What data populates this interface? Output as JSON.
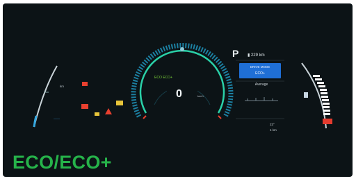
{
  "caption": "ECO/ECO+",
  "cluster": {
    "gear": "P",
    "range": "▮ 229 km",
    "drive_mode_title": "DRIVE MODE",
    "drive_mode": "ECO+",
    "average_label": "Average",
    "speed": "0",
    "speed_unit": "km/h",
    "eco_readout": "ECO   ECO+",
    "odometer": "23°",
    "trip": "1 km",
    "left_label": "km",
    "left_bottom": "——"
  },
  "colors": {
    "caption": "#26b34a",
    "panel": "#0c1316",
    "gauge_outer": "#1a8fb0",
    "gauge_inner": "#2ad0a8",
    "drive_mode_box": "#1f6fd6",
    "battery_bar": "#ffffff",
    "battery_low": "#e33b2e",
    "warning_red": "#e8402f",
    "warning_yellow": "#e8c53a"
  }
}
